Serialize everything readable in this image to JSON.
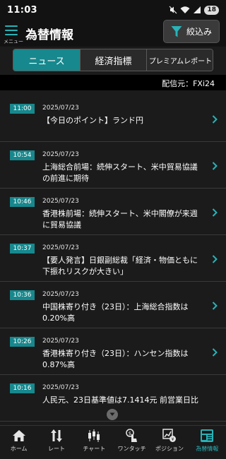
{
  "status_bar": {
    "time": "11:03",
    "battery": "18"
  },
  "header": {
    "menu_label": "メニュー",
    "title": "為替情報",
    "filter_label": "絞込み"
  },
  "tabs": [
    {
      "label": "ニュース",
      "active": true
    },
    {
      "label": "経済指標",
      "active": false
    },
    {
      "label": "プレミアムレポート",
      "active": false
    }
  ],
  "source": "配信元：FXi24",
  "news": [
    {
      "time": "11:00",
      "date": "2025/07/23",
      "title": "【今日のポイント】ランド円"
    },
    {
      "time": "10:54",
      "date": "2025/07/23",
      "title": "上海総合前場：続伸スタート、米中貿易協議の前進に期待"
    },
    {
      "time": "10:46",
      "date": "2025/07/23",
      "title": "香港株前場：続伸スタート、米中閣僚が来週に貿易協議"
    },
    {
      "time": "10:37",
      "date": "2025/07/23",
      "title": "【要人発言】日銀副総裁「経済・物価ともに下振れリスクが大きい」"
    },
    {
      "time": "10:36",
      "date": "2025/07/23",
      "title": "中国株寄り付き（23日）：上海総合指数は0.20%高"
    },
    {
      "time": "10:26",
      "date": "2025/07/23",
      "title": "香港株寄り付き（23日）：ハンセン指数は0.87%高"
    },
    {
      "time": "10:16",
      "date": "2025/07/23",
      "title": "人民元、23日基準値は7.1414元 前営業日比"
    }
  ],
  "bottom_nav": [
    {
      "label": "ホーム",
      "icon": "home-icon",
      "active": false
    },
    {
      "label": "レート",
      "icon": "rate-icon",
      "active": false
    },
    {
      "label": "チャート",
      "icon": "chart-icon",
      "active": false
    },
    {
      "label": "ワンタッチ",
      "icon": "one-touch-icon",
      "active": false
    },
    {
      "label": "ポジション",
      "icon": "position-icon",
      "active": false
    },
    {
      "label": "為替情報",
      "icon": "news-icon",
      "active": true
    }
  ],
  "colors": {
    "accent": "#17888d",
    "accent_light": "#27b3b8",
    "background": "#1b1b1b"
  }
}
